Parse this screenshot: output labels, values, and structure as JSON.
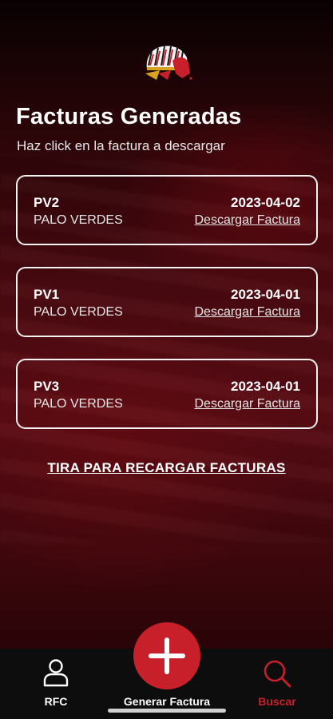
{
  "header": {
    "title": "Facturas Generadas",
    "subtitle": "Haz click en la factura a descargar"
  },
  "invoices": [
    {
      "code": "PV2",
      "branch": "PALO VERDES",
      "date": "2023-04-02",
      "download_label": "Descargar Factura"
    },
    {
      "code": "PV1",
      "branch": "PALO VERDES",
      "date": "2023-04-01",
      "download_label": "Descargar Factura"
    },
    {
      "code": "PV3",
      "branch": "PALO VERDES",
      "date": "2023-04-01",
      "download_label": "Descargar Factura"
    }
  ],
  "reload_label": "TIRA PARA RECARGAR FACTURAS",
  "tabbar": {
    "rfc": {
      "label": "RFC",
      "icon": "user-icon"
    },
    "generate": {
      "label": "Generar Factura",
      "icon": "plus-icon"
    },
    "search": {
      "label": "Buscar",
      "icon": "search-icon",
      "active": true
    }
  },
  "colors": {
    "accent": "#c8202a",
    "tabbar_bg": "#0d0d0d",
    "card_border": "#f2f2f2"
  }
}
